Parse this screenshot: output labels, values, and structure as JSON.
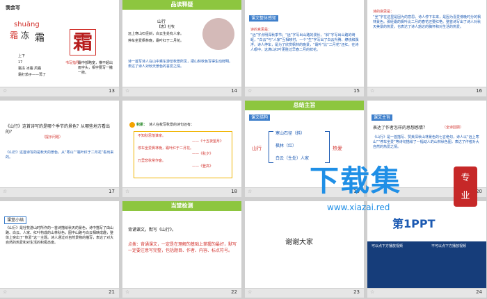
{
  "slides": [
    {
      "num": "13",
      "title": "我会写",
      "pinyin": "shuāng",
      "chars": [
        "霜",
        "冻",
        "霜"
      ],
      "big": "霜",
      "structure": "上下",
      "radical_label": "部首",
      "strokes": "17",
      "writing_label": "书写指导：",
      "writing_tip": "霜中部略宽，横不超出雨字头，相字要写一撇一捺。",
      "words": "霜冻 冰霜 风霜",
      "sentence": "霜打茄子——蔫了"
    },
    {
      "num": "14",
      "header": "品读释疑",
      "poem_title": "山行",
      "author": "【唐】杜牧",
      "lines": [
        "远上寒山石径斜，白云生处有人家。",
        "停车坐爱枫林晚，霜叶红于二月花。"
      ],
      "note": "诗一首写诗人在山中乘车游览秋景所见，把山林秋色写得生动鲜明。表达了诗人对秋天景色的喜爱之情。"
    },
    {
      "num": "15",
      "title": "课文整体感知",
      "label": "诗的意思是：",
      "text": "“远”字点明深秋季节；“远”字写出山路的漫长，“斜”字写出山路的崎岖，“白云”与“人家”互相映衬，一个“生”字写出了白云升腾、缭绕和飘浮。诗人停车，是为了欣赏枫林的晚景，“霜叶”比“二月花”还红，在诗人眼中，这满山红叶更胜过早春二月的鲜花。"
    },
    {
      "num": "16",
      "label": "诗的意思是：",
      "text": "“坐”字在这里是因为的意思。诗人停下车来，是因为喜爱傍晚时分的枫林景色。那经霜的枫叶比二月的春花还要红艳。整首诗写出了诗人对秋天美景的热爱，也表达了诗人豁达的胸怀和对生活的热爱。"
    },
    {
      "num": "17",
      "q": "《山行》这首诗写的是哪个季节的景色？从哪些地方看出的？",
      "hint": "（提示问题）",
      "a": "《山行》这首诗写的是秋天的景色，从“寒山”“霜叶红于二月花”看出来的。"
    },
    {
      "num": "18",
      "icon_label": "积累：",
      "title": "诗人在枚写秋景的诗句还有：",
      "items": [
        "不知秋思落谁家。",
        "——《十五夜望月》",
        "停车坐爱枫林晚，霜叶红于二月花。",
        "——《秋夕》",
        "万里悲秋常作客。",
        "——《登高》"
      ]
    },
    {
      "num": "19",
      "header": "总结主旨",
      "title": "课文结构",
      "lead": "山行",
      "branches": [
        "寒山石径（斜）",
        "枫林（红）",
        "白云（生处）人家"
      ],
      "result": "热爱"
    },
    {
      "num": "20",
      "title": "课文主旨",
      "q": "表达了作者怎样的思想感情？",
      "hint": "（全诗回顾）",
      "text": "《山行》是一首描写、赞美深秋山林景色的七言绝句，诗人以“远上寒山”“停车坐爱”等诗句描绘了一幅动人的山林秋色图，表达了作者对大自然的热爱之情。"
    },
    {
      "num": "21",
      "title": "课堂小结",
      "text": "《山行》是杜牧游山时所作的一首诗描绘秋天的景色，诗中描写了由山路、白云、人家、红叶构成的山林秋色，图中山路与白云相映成趣，整体上突出了“热爱”这一主题。诗人通过对自然景物的描写，表达了对大自然的热爱和对生活的积极态度。"
    },
    {
      "num": "22",
      "header": "当堂检测",
      "title": "背诵课文，默写《山行》。",
      "text": "点拨：背诵课文，一定是在理解的基础上掌握的最好，默写一定要注意写完整，包括题目、作者、内容、标点符号。"
    },
    {
      "num": "23",
      "text": "谢谢大家"
    },
    {
      "num": "24",
      "brand": "第1PPT",
      "promo1": "可以点下方播放视频",
      "promo2": "不可以点下方播放视频"
    }
  ],
  "watermark": {
    "main": "下载集",
    "side": "专业",
    "url": "www.xiazai.red"
  }
}
